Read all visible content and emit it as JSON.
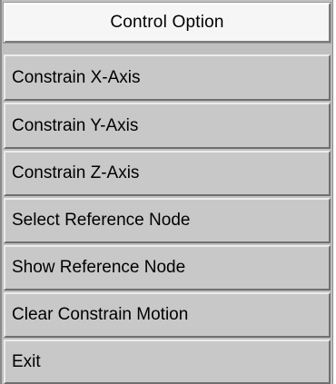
{
  "menu": {
    "title": "Control Option",
    "items": [
      {
        "label": "Constrain X-Axis"
      },
      {
        "label": "Constrain Y-Axis"
      },
      {
        "label": "Constrain Z-Axis"
      },
      {
        "label": "Select Reference Node"
      },
      {
        "label": "Show Reference Node"
      },
      {
        "label": "Clear Constrain Motion"
      },
      {
        "label": "Exit"
      }
    ]
  }
}
